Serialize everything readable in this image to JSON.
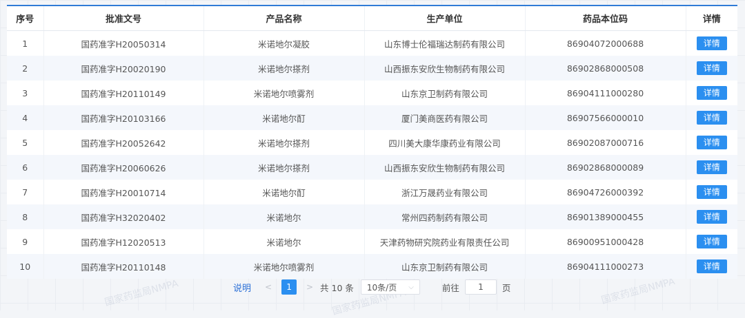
{
  "table": {
    "headers": [
      "序号",
      "批准文号",
      "产品名称",
      "生产单位",
      "药品本位码",
      "详情"
    ],
    "detail_label": "详情",
    "rows": [
      {
        "no": "1",
        "approval": "国药准字H20050314",
        "product": "米诺地尔凝胶",
        "maker": "山东博士伦福瑞达制药有限公司",
        "code": "86904072000688"
      },
      {
        "no": "2",
        "approval": "国药准字H20020190",
        "product": "米诺地尔搽剂",
        "maker": "山西振东安欣生物制药有限公司",
        "code": "86902868000508"
      },
      {
        "no": "3",
        "approval": "国药准字H20110149",
        "product": "米诺地尔喷雾剂",
        "maker": "山东京卫制药有限公司",
        "code": "86904111000280"
      },
      {
        "no": "4",
        "approval": "国药准字H20103166",
        "product": "米诺地尔酊",
        "maker": "厦门美商医药有限公司",
        "code": "86907566000010"
      },
      {
        "no": "5",
        "approval": "国药准字H20052642",
        "product": "米诺地尔搽剂",
        "maker": "四川美大康华康药业有限公司",
        "code": "86902087000716"
      },
      {
        "no": "6",
        "approval": "国药准字H20060626",
        "product": "米诺地尔搽剂",
        "maker": "山西振东安欣生物制药有限公司",
        "code": "86902868000089"
      },
      {
        "no": "7",
        "approval": "国药准字H20010714",
        "product": "米诺地尔酊",
        "maker": "浙江万晟药业有限公司",
        "code": "86904726000392"
      },
      {
        "no": "8",
        "approval": "国药准字H32020402",
        "product": "米诺地尔",
        "maker": "常州四药制药有限公司",
        "code": "86901389000455"
      },
      {
        "no": "9",
        "approval": "国药准字H12020513",
        "product": "米诺地尔",
        "maker": "天津药物研究院药业有限责任公司",
        "code": "86900951000428"
      },
      {
        "no": "10",
        "approval": "国药准字H20110148",
        "product": "米诺地尔喷雾剂",
        "maker": "山东京卫制药有限公司",
        "code": "86904111000273"
      }
    ]
  },
  "pager": {
    "note": "说明",
    "prev": "<",
    "current_page": "1",
    "next": ">",
    "total": "共 10 条",
    "page_size": "10条/页",
    "goto_prefix": "前往",
    "goto_value": "1",
    "goto_suffix": "页"
  },
  "watermark": "国家药监局NMPA",
  "colors": {
    "accent": "#2b8ff0",
    "header_line": "#2f7bd6"
  }
}
